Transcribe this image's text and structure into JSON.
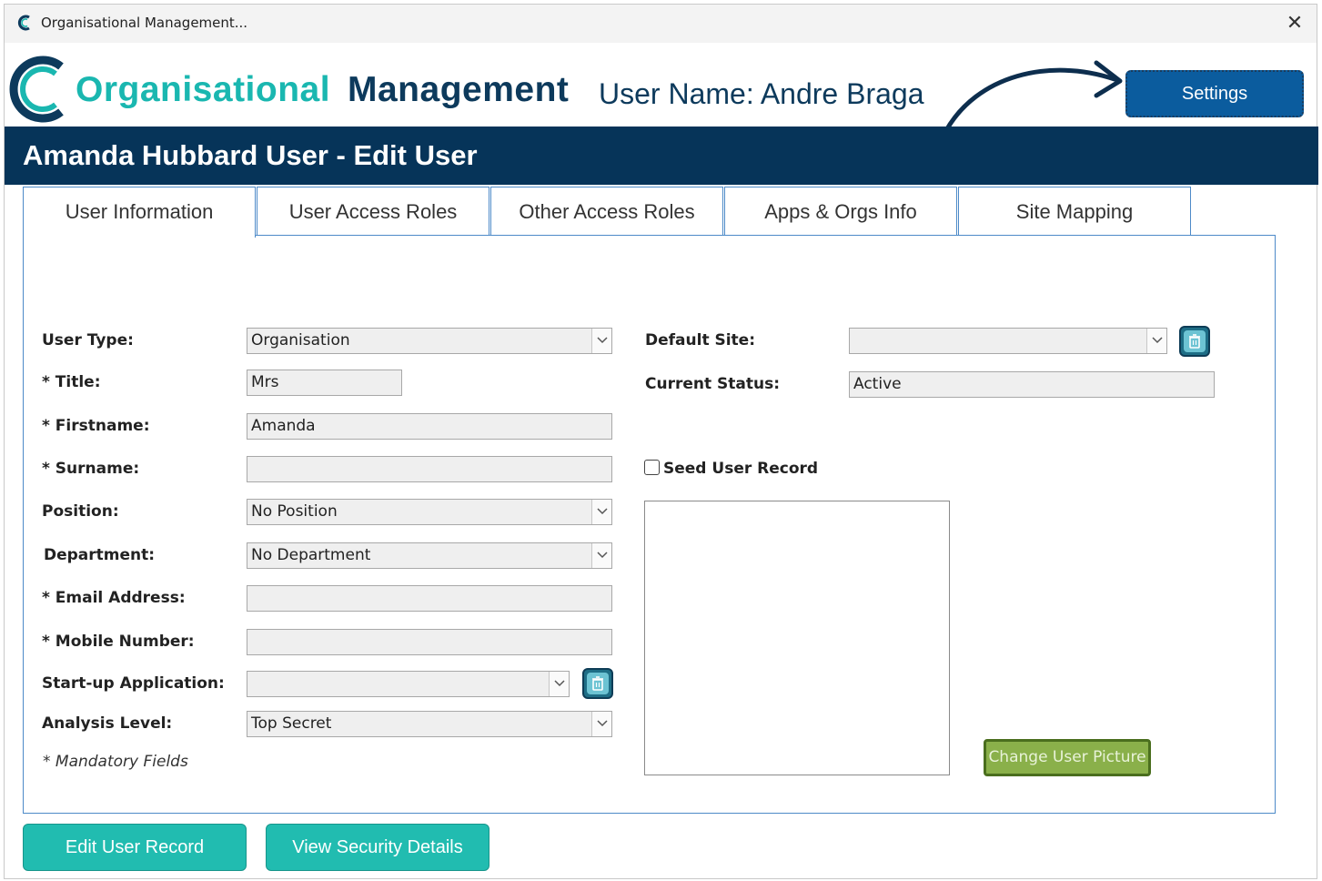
{
  "window": {
    "title": "Organisational Management...",
    "close_glyph": "✕"
  },
  "header": {
    "brand_part1": "Organisational",
    "brand_part2": "Management",
    "user_name": "User Name: Andre Braga",
    "settings_label": "Settings",
    "banner_title": "Amanda Hubbard User - Edit User"
  },
  "tabs": [
    {
      "label": "User Information",
      "active": true
    },
    {
      "label": "User Access Roles",
      "active": false
    },
    {
      "label": "Other Access Roles",
      "active": false
    },
    {
      "label": "Apps & Orgs Info",
      "active": false
    },
    {
      "label": "Site Mapping",
      "active": false
    }
  ],
  "form": {
    "user_type": {
      "label": "User Type:",
      "value": "Organisation"
    },
    "title": {
      "label": "* Title:",
      "value": "Mrs"
    },
    "firstname": {
      "label": "* Firstname:",
      "value": "Amanda"
    },
    "surname": {
      "label": "* Surname:",
      "value": ""
    },
    "position": {
      "label": "Position:",
      "value": "No Position"
    },
    "department": {
      "label": "Department:",
      "value": "No Department"
    },
    "email": {
      "label": "* Email Address:",
      "value": ""
    },
    "mobile": {
      "label": "* Mobile Number:",
      "value": ""
    },
    "startup_app": {
      "label": "Start-up Application:",
      "value": ""
    },
    "analysis_level": {
      "label": "Analysis Level:",
      "value": "Top Secret"
    },
    "mandatory_note": "* Mandatory Fields",
    "default_site": {
      "label": "Default Site:",
      "value": ""
    },
    "current_status": {
      "label": "Current Status:",
      "value": "Active"
    },
    "seed_user_record": {
      "label": "Seed User Record",
      "checked": false
    },
    "change_picture_label": "Change User Picture"
  },
  "actions": {
    "edit_user_record": "Edit User Record",
    "view_security_details": "View Security Details"
  },
  "colors": {
    "brand_teal": "#1ab7b0",
    "brand_navy": "#0d3a5c",
    "banner_bg": "#063459",
    "settings_btn": "#0b5c9e",
    "action_btn": "#21bcb0",
    "picture_btn": "#8ab04a"
  },
  "icons": [
    "app-logo-icon",
    "close-icon",
    "brand-logo-icon",
    "curved-arrow-icon",
    "chevron-down-icon",
    "trash-icon"
  ]
}
